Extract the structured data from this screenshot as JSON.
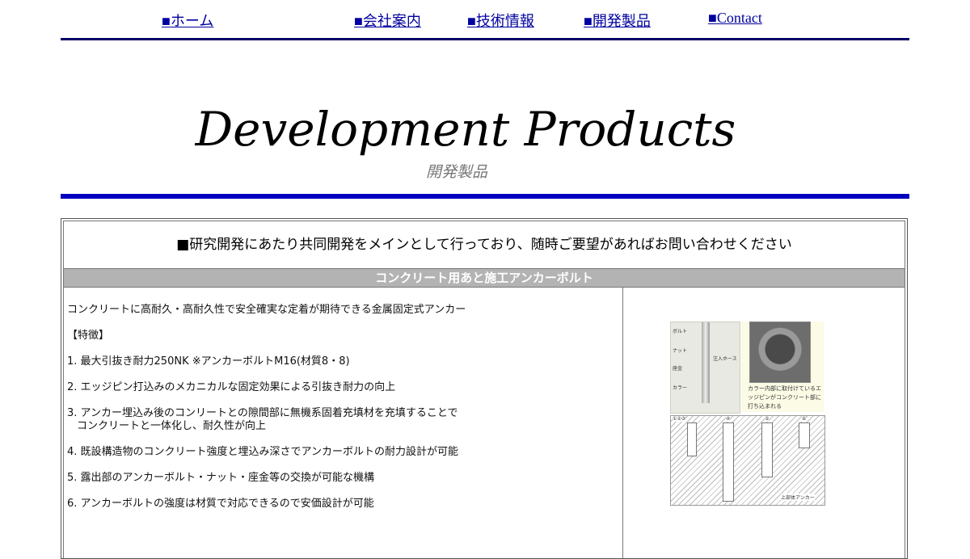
{
  "nav": {
    "items": [
      {
        "bullet": "■",
        "label": "ホーム"
      },
      {
        "bullet": "■",
        "label": "会社案内"
      },
      {
        "bullet": "■",
        "label": "技術情報"
      },
      {
        "bullet": "■",
        "label": "開発製品"
      },
      {
        "bullet": "■",
        "label": "Contact"
      }
    ]
  },
  "hero": {
    "title": "Development Products",
    "subtitle": "開発製品"
  },
  "intro": "■研究開発にあたり共同開発をメインとして行っており、随時ご要望があればお問い合わせください",
  "section": {
    "title": "コンクリート用あと施工アンカーボルト",
    "lead": "コンクリートに高耐久・高耐久性で安全確実な定着が期待できる金属固定式アンカー",
    "features_heading": "【特徴】",
    "features": [
      {
        "line1": "1. 最大引抜き耐力250NK ※アンカーボルトM16(材質8・8)",
        "line2": ""
      },
      {
        "line1": "2. エッジピン打込みのメカニカルな固定効果による引抜き耐力の向上",
        "line2": ""
      },
      {
        "line1": "3. アンカー埋込み後のコンリートとの隙間部に無機系固着充填材を充填することで",
        "line2": "コンクリートと一体化し、耐久性が向上"
      },
      {
        "line1": "4. 既設構造物のコンクリート強度と埋込み深さでアンカーボルトの耐力設計が可能",
        "line2": ""
      },
      {
        "line1": "5. 露出部のアンカーボルト・ナット・座金等の交換が可能な機構",
        "line2": ""
      },
      {
        "line1": "6. アンカーボルトの強度は材質で対応できるので安価設計が可能",
        "line2": ""
      }
    ],
    "image": {
      "labels": [
        "ボルト",
        "ナット",
        "座金",
        "カラー",
        "注入ホース"
      ],
      "caption": "カラー内部に取付けているエッジピンがコンクリート部に打ち込まれる",
      "diagram_steps": [
        "①②③",
        "④",
        "⑤",
        "⑥"
      ],
      "diagram_note": "上部体アンカー"
    }
  },
  "colors": {
    "nav_link": "#0000a0",
    "nav_rule": "#000066",
    "hero_rule": "#0000c0",
    "section_head_bg": "#b3b3b3"
  }
}
